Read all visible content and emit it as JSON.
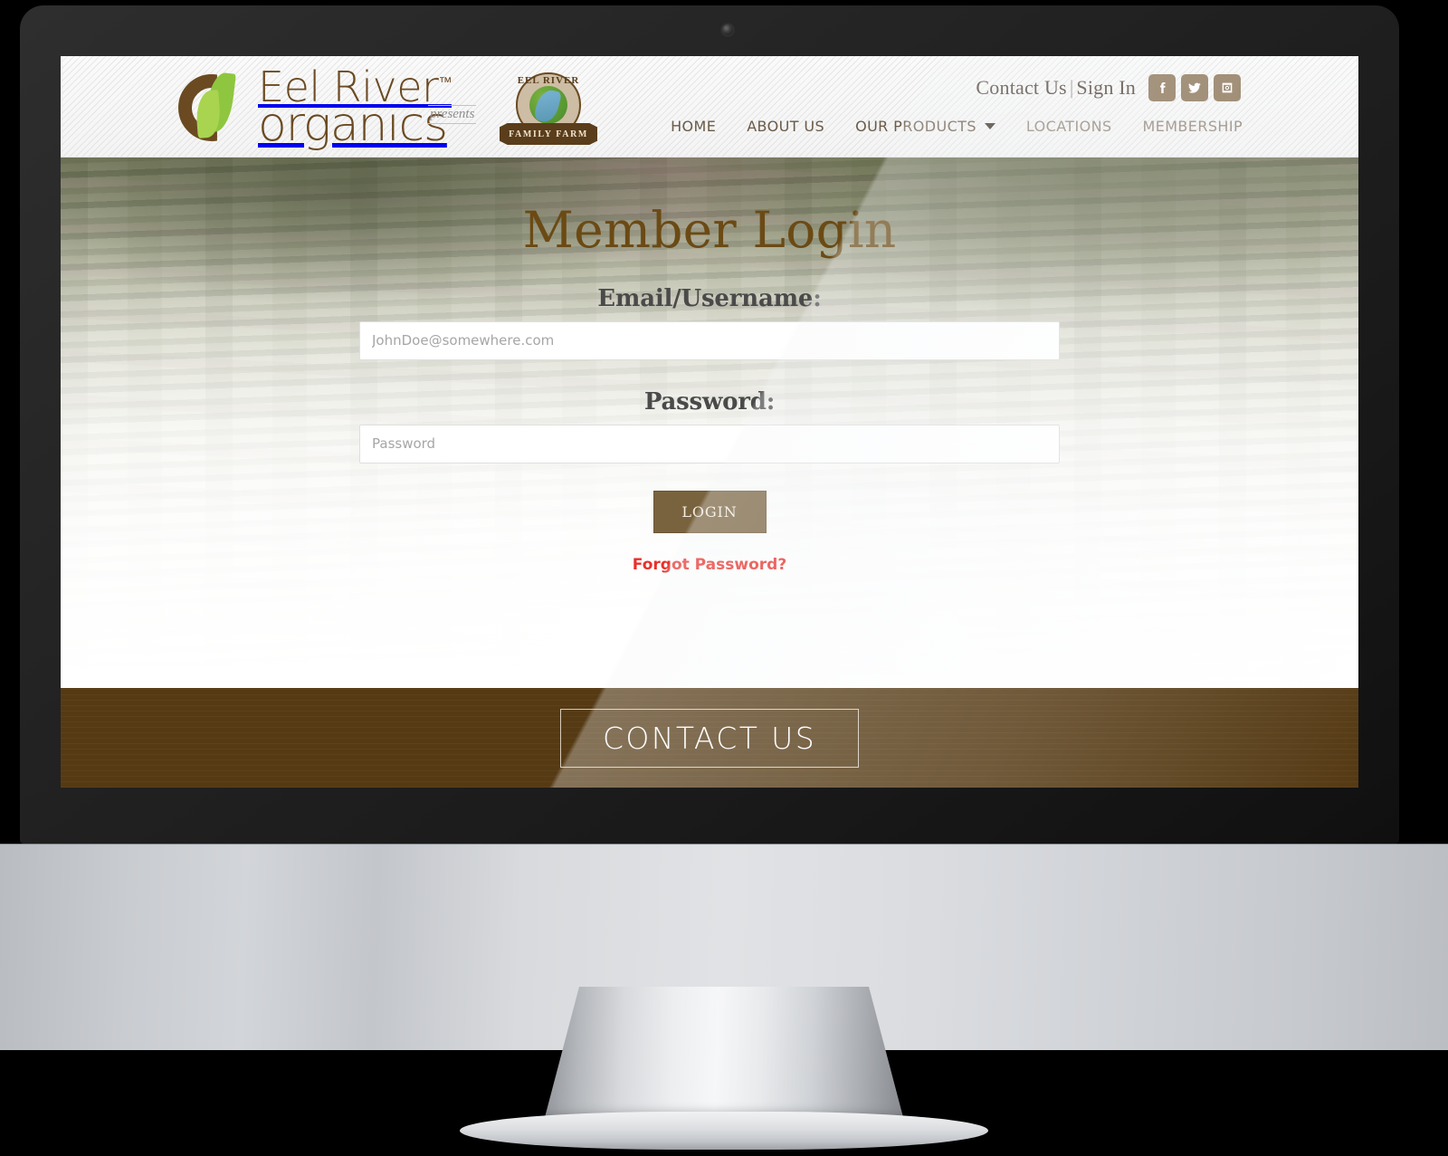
{
  "header": {
    "brand": {
      "line1": "Eel River",
      "tm": "™",
      "line2": "organics",
      "logo_icon": "leaf-circle-icon"
    },
    "presents_label": "presents",
    "farm_badge": {
      "arc_text": "EEL RIVER",
      "ribbon_text": "FAMILY FARM",
      "globe_icon": "river-globe-icon"
    },
    "utility": {
      "contact_label": "Contact Us",
      "separator": "|",
      "signin_label": "Sign In"
    },
    "social": [
      {
        "name": "facebook-icon",
        "label": "Facebook"
      },
      {
        "name": "twitter-icon",
        "label": "Twitter"
      },
      {
        "name": "instagram-icon",
        "label": "Instagram"
      }
    ],
    "social_bg": "#8c7558",
    "nav": [
      {
        "label": "HOME",
        "has_caret": false,
        "muted": false
      },
      {
        "label": "ABOUT US",
        "has_caret": false,
        "muted": false
      },
      {
        "label": "OUR PRODUCTS",
        "has_caret": true,
        "muted": false
      },
      {
        "label": "LOCATIONS",
        "has_caret": false,
        "muted": true
      },
      {
        "label": "MEMBERSHIP",
        "has_caret": false,
        "muted": true
      }
    ]
  },
  "hero": {
    "title": "Member Login",
    "email": {
      "label": "Email/Username:",
      "placeholder": "JohnDoe@somewhere.com",
      "value": ""
    },
    "password": {
      "label": "Password:",
      "placeholder": "Password",
      "value": ""
    },
    "login_button": "LOGIN",
    "forgot_link": "Forgot Password?",
    "title_color": "#6b4a14",
    "button_color": "#79633f",
    "forgot_color": "#e8302a"
  },
  "footer": {
    "cta_label": "CONTACT US",
    "background": "#553a14"
  }
}
